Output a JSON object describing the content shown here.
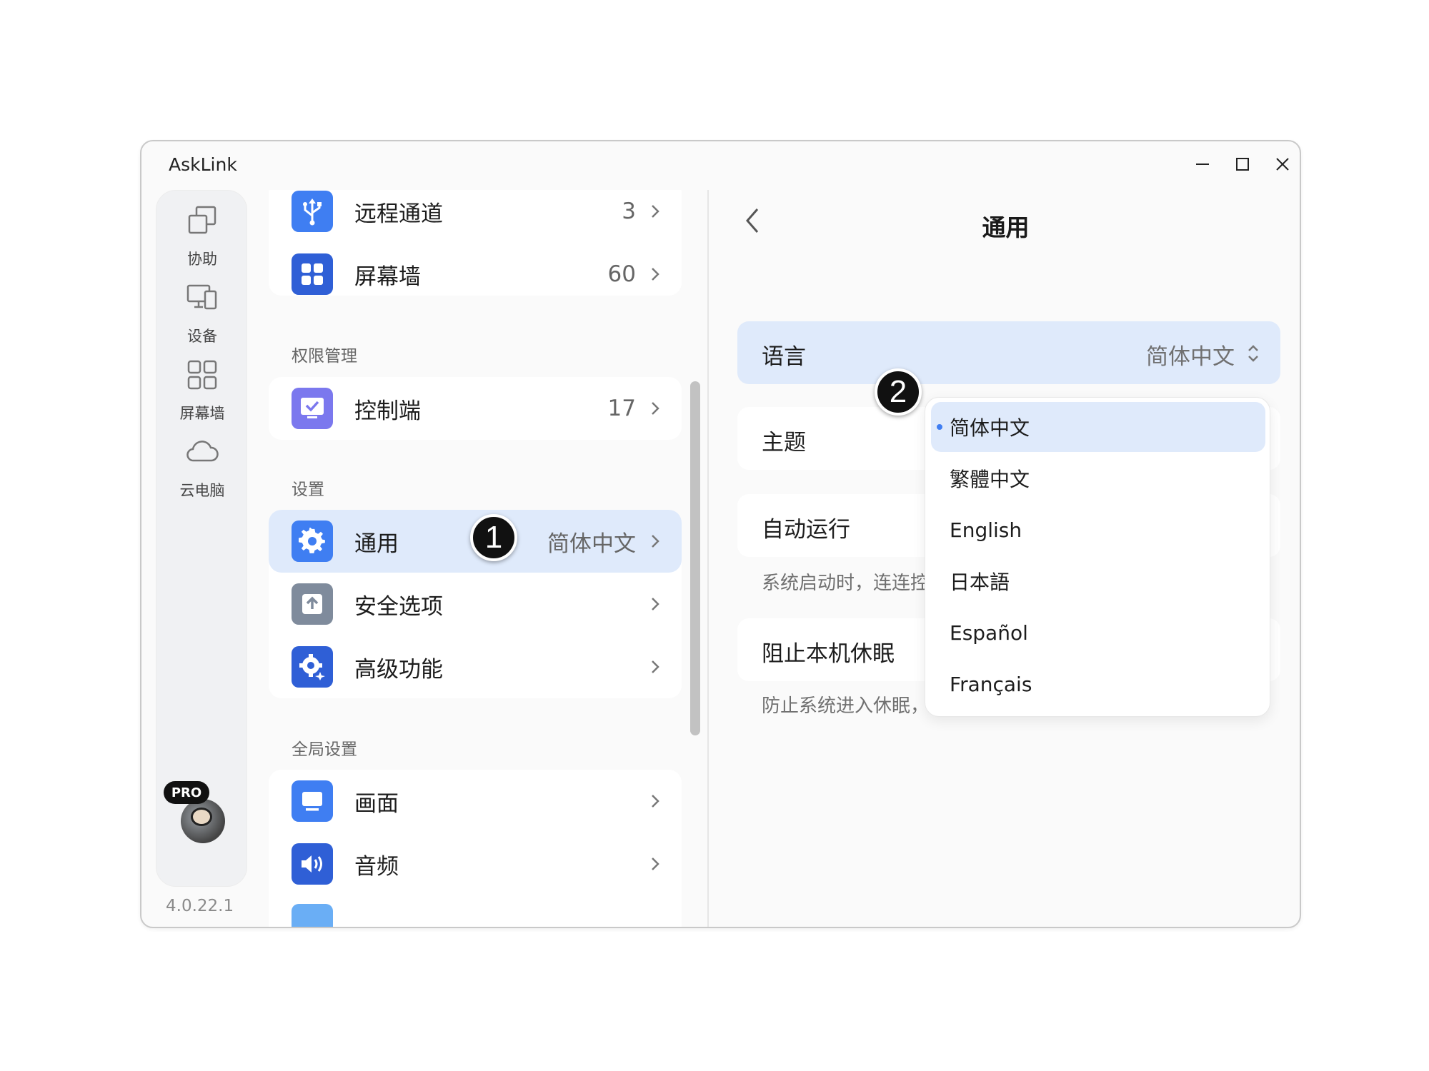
{
  "window": {
    "title": "AskLink"
  },
  "rail": {
    "items": [
      {
        "label": "协助",
        "icon": "copy-windows-icon"
      },
      {
        "label": "设备",
        "icon": "devices-icon"
      },
      {
        "label": "屏幕墙",
        "icon": "grid-icon"
      },
      {
        "label": "云电脑",
        "icon": "cloud-icon"
      }
    ],
    "badge": "PRO",
    "version": "4.0.22.1"
  },
  "list": {
    "top_rows": [
      {
        "label": "远程通道",
        "value": "3",
        "icon": "usb-icon",
        "color": "#3f7ef2"
      },
      {
        "label": "屏幕墙",
        "value": "60",
        "icon": "grid-icon",
        "color": "#2f5fd6"
      }
    ],
    "sections": [
      {
        "title": "权限管理"
      },
      {
        "title": "设置"
      },
      {
        "title": "全局设置"
      }
    ],
    "permission_rows": [
      {
        "label": "控制端",
        "value": "17",
        "icon": "monitor-check-icon",
        "color": "#7b78ee"
      }
    ],
    "settings_rows": [
      {
        "label": "通用",
        "value": "简体中文",
        "icon": "gear-icon",
        "color": "#3f7ef2"
      },
      {
        "label": "安全选项",
        "value": "",
        "icon": "upload-shield-icon",
        "color": "#7f8b9c"
      },
      {
        "label": "高级功能",
        "value": "",
        "icon": "advanced-gear-icon",
        "color": "#2f5fd6"
      }
    ],
    "global_rows": [
      {
        "label": "画面",
        "value": "",
        "icon": "display-icon",
        "color": "#3f7ef2"
      },
      {
        "label": "音频",
        "value": "",
        "icon": "speaker-icon",
        "color": "#2f5fd6"
      }
    ]
  },
  "panel": {
    "title": "通用",
    "language": {
      "label": "语言",
      "value": "简体中文"
    },
    "theme": {
      "label": "主题"
    },
    "autorun": {
      "label": "自动运行",
      "desc": "系统启动时，连连控"
    },
    "nosleep": {
      "label": "阻止本机休眠",
      "desc": "防止系统进入休眠，"
    }
  },
  "dropdown": {
    "options": [
      "简体中文",
      "繁體中文",
      "English",
      "日本語",
      "Español",
      "Français"
    ],
    "selected": "简体中文"
  },
  "markers": [
    "1",
    "2"
  ],
  "colors": {
    "accent": "#3f7ef2",
    "selected_bg": "#dfeafb"
  }
}
